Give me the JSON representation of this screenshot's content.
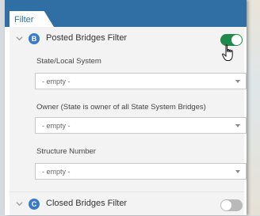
{
  "panel": {
    "tab_label": "Filter"
  },
  "sections": [
    {
      "title": "Posted Bridges Filter",
      "badge": "B",
      "expanded": true,
      "enabled": true,
      "fields": [
        {
          "label": "State/Local System",
          "value": "- empty -"
        },
        {
          "label": "Owner (State is owner of all State System Bridges)",
          "value": "- empty -"
        },
        {
          "label": "Structure Number",
          "value": "- empty -"
        }
      ]
    },
    {
      "title": "Closed Bridges Filter",
      "badge": "C",
      "expanded": false,
      "enabled": false
    }
  ],
  "colors": {
    "header": "#2f6fa3",
    "toggle_on": "#1f8a4c",
    "toggle_off": "#b9b9b9",
    "badge": "#3a7bc8"
  },
  "icons": {
    "expand": "chevron-down-icon",
    "cursor": "hand-pointer-icon",
    "dropdown": "caret-down-icon"
  }
}
